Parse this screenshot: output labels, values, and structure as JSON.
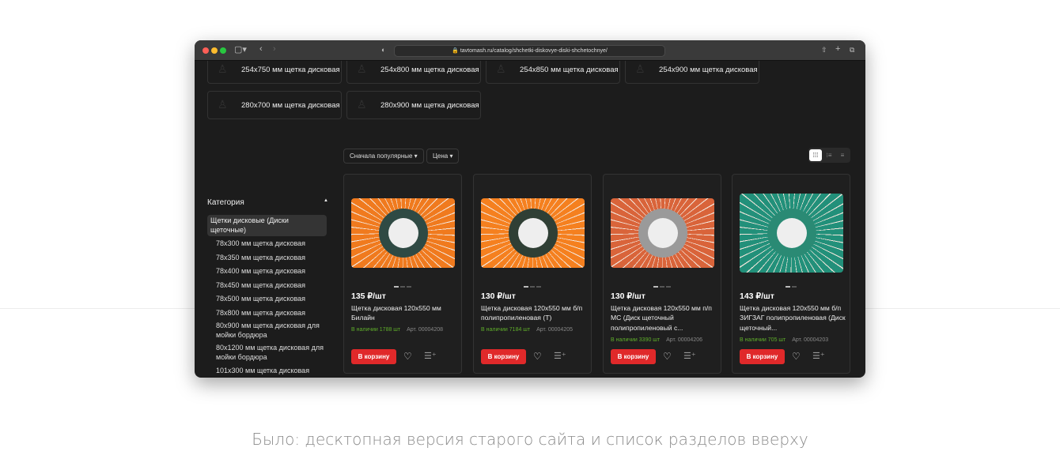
{
  "browser": {
    "url": "tavtomash.ru/catalog/shchetki-diskovye-diski-shchetochnye/"
  },
  "chips": [
    "254x750 мм щетка дисковая",
    "254x800 мм щетка дисковая",
    "254x850 мм щетка дисковая",
    "254x900 мм щетка дисковая",
    "280x700 мм щетка дисковая",
    "280x900 мм щетка дисковая"
  ],
  "sort": {
    "popular": "Сначала популярные",
    "price": "Цена"
  },
  "sidebar": {
    "heading": "Категория",
    "selected": "Щетки дисковые (Диски щеточные)",
    "items": [
      "78x300 мм щетка дисковая",
      "78x350 мм щетка дисковая",
      "78x400 мм щетка дисковая",
      "78x450 мм щетка дисковая",
      "78x500 мм щетка дисковая",
      "78x800 мм щетка дисковая",
      "80x900 мм щетка дисковая для мойки бордюра",
      "80x1200 мм щетка дисковая для мойки бордюра",
      "101x300 мм щетка дисковая"
    ]
  },
  "products": [
    {
      "price": "135 ₽/шт",
      "title": "Щетка дисковая 120x550 мм Билайн",
      "stock": "В наличии 1788 шт",
      "art": "Арт. 00004208",
      "cart": "В корзину",
      "color": "#f07a1e",
      "hub": "#2f4a44"
    },
    {
      "price": "130 ₽/шт",
      "title": "Щетка дисковая 120x550 мм б/п полипропиленовая (Т)",
      "stock": "В наличии 7184 шт",
      "art": "Арт. 00004205",
      "cart": "В корзину",
      "color": "#f5801f",
      "hub": "#2f3f35"
    },
    {
      "price": "130 ₽/шт",
      "title": "Щетка дисковая 120x550 мм п/п МС (Диск щеточный полипропиленовый с...",
      "stock": "В наличии 3390 шт",
      "art": "Арт. 00004206",
      "cart": "В корзину",
      "color": "#d9643a",
      "hub": "#9a9a9a"
    },
    {
      "price": "143 ₽/шт",
      "title": "Щетка дисковая 120x550 мм б/п ЗИГЗАГ полипропиленовая (Диск щеточный...",
      "stock": "В наличии 705 шт",
      "art": "Арт. 00004203",
      "cart": "В корзину",
      "color": "#22907a",
      "hub": "#2a8a74"
    }
  ],
  "caption": "Было: десктопная версия старого сайта и список разделов вверху"
}
